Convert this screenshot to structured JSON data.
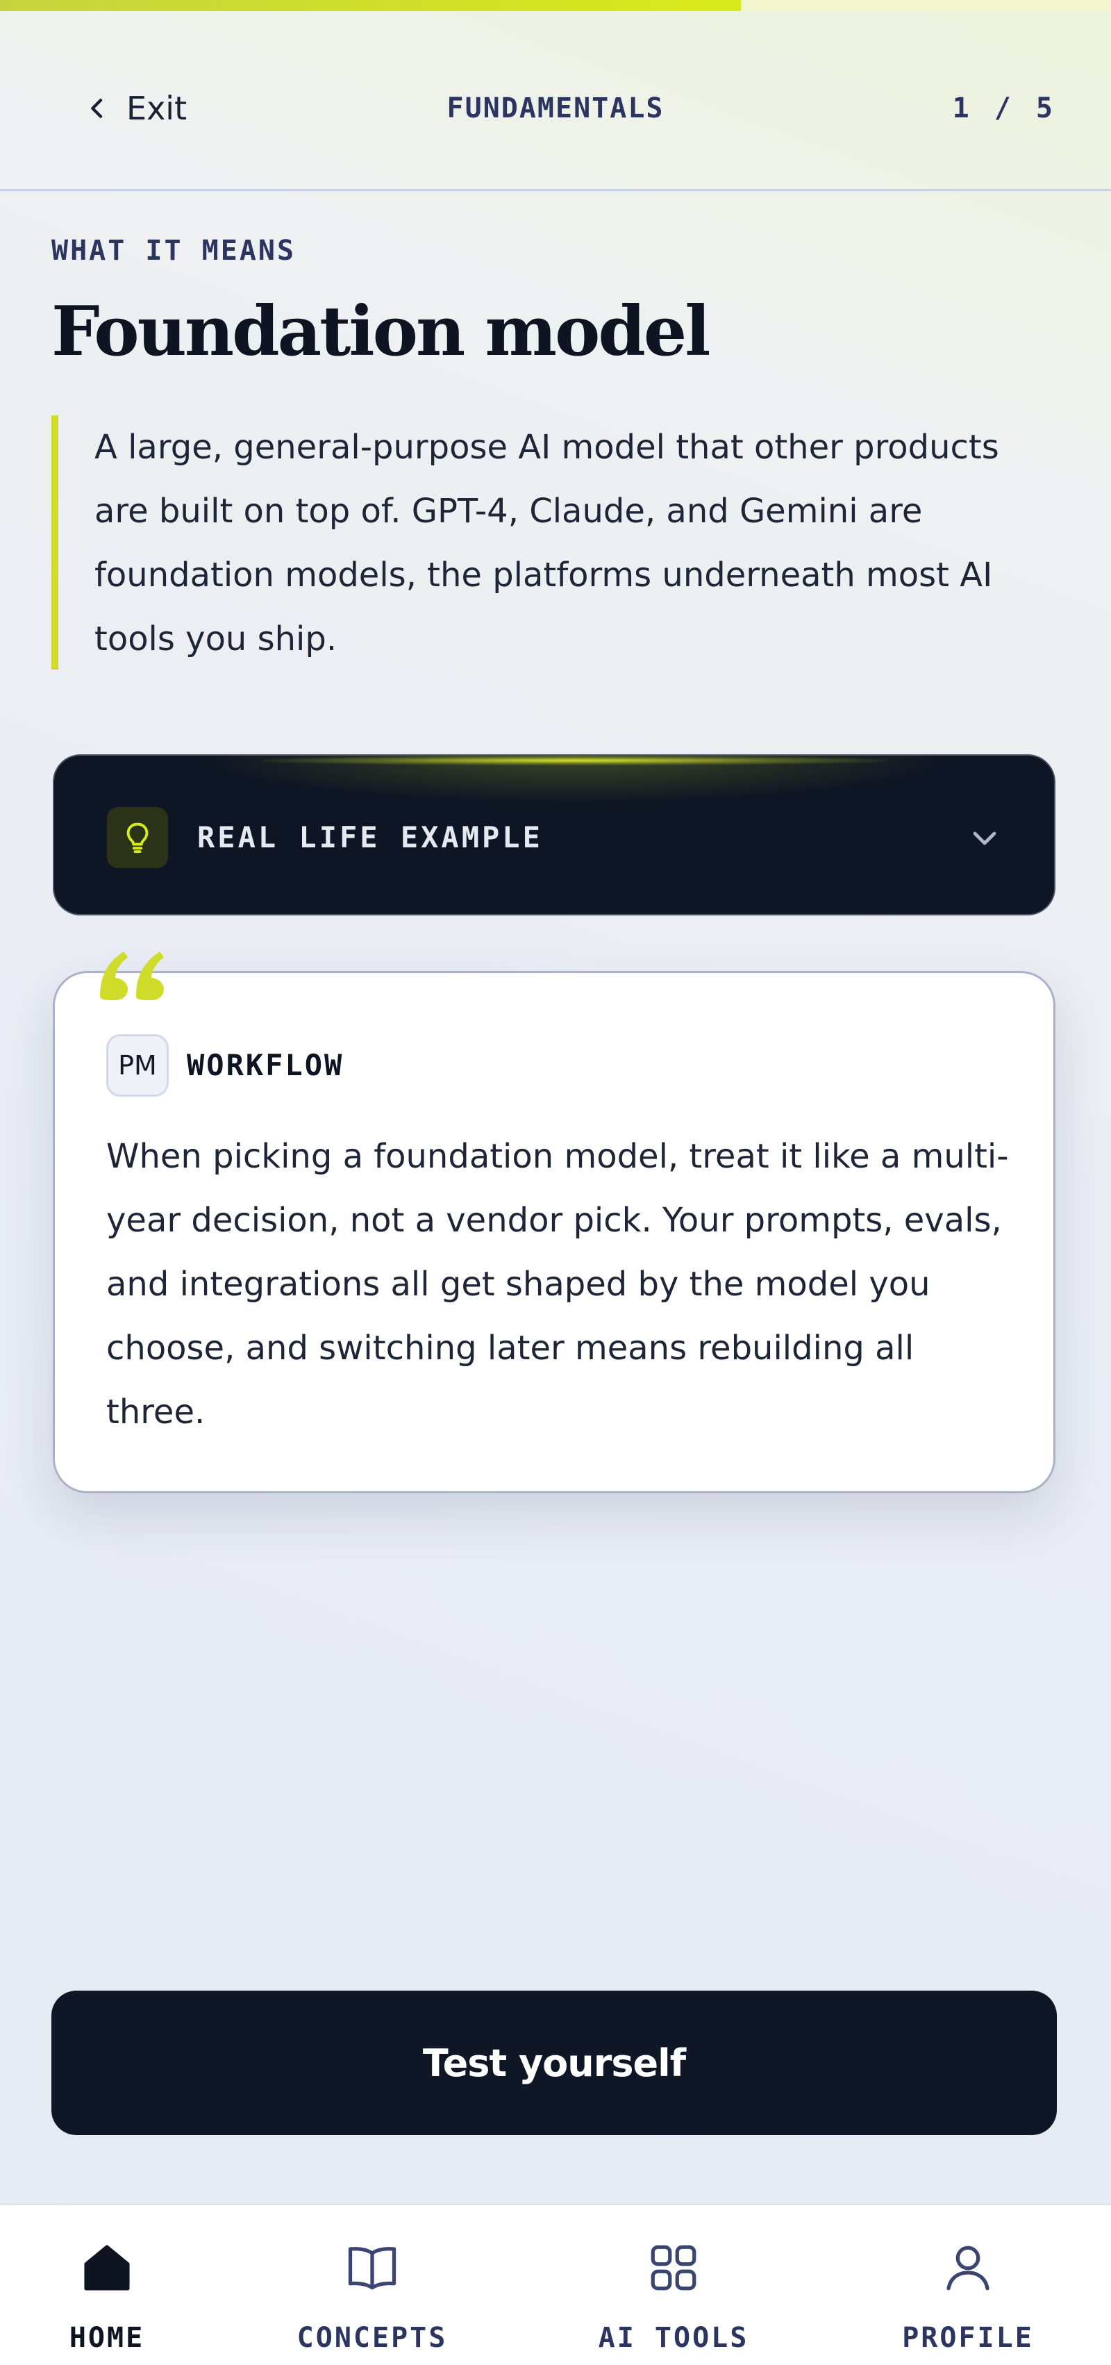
{
  "progress": {
    "fraction": 0.667
  },
  "header": {
    "exit_label": "Exit",
    "section": "FUNDAMENTALS",
    "step": "1 / 5"
  },
  "definition": {
    "eyebrow": "WHAT IT MEANS",
    "title": "Foundation model",
    "text": "A large, general-purpose AI model that other products are built on top of. GPT-4, Claude, and Gemini are foundation models, the platforms underneath most AI tools you ship."
  },
  "example": {
    "label": "REAL LIFE EXAMPLE",
    "icon": "lightbulb-icon",
    "toggle_icon": "chevron-down-icon"
  },
  "workflow": {
    "badge": "PM",
    "label": "WORKFLOW",
    "text": "When picking a foundation model, treat it like a multi-year decision, not a vendor pick. Your prompts, evals, and integrations all get shaped by the model you choose, and switching later means rebuilding all three."
  },
  "cta": {
    "label": "Test yourself"
  },
  "nav": {
    "items": [
      {
        "label": "HOME",
        "icon": "home-icon",
        "active": true
      },
      {
        "label": "CONCEPTS",
        "icon": "book-icon",
        "active": false
      },
      {
        "label": "AI TOOLS",
        "icon": "grid-icon",
        "active": false
      },
      {
        "label": "PROFILE",
        "icon": "user-icon",
        "active": false
      }
    ]
  },
  "colors": {
    "accent": "#d9ea1a",
    "dark": "#0f1626",
    "muted_text": "#2b3560"
  }
}
